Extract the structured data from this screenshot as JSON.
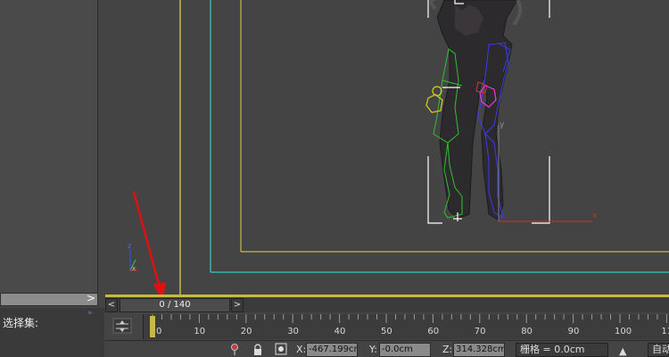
{
  "left_panel": {
    "scroll_arrow": ">",
    "selection_set_label": "选择集:",
    "collapse_chevron": "»"
  },
  "viewport": {
    "axis_y_label": "y",
    "axis_x_label": "x",
    "gizmo_z_label": "z",
    "gizmo_x_label": "x",
    "frame_colors": {
      "safe_yellow": "#c8b84a",
      "safe_cyan": "#38c8c8"
    },
    "annotation_color": "#e01010"
  },
  "time_slider": {
    "prev_label": "<",
    "next_label": ">",
    "frame_readout": "0 / 140"
  },
  "track_bar": {
    "ticks": [
      "0",
      "10",
      "20",
      "30",
      "40",
      "50",
      "60",
      "70",
      "80",
      "90",
      "100",
      "11"
    ]
  },
  "status_bar": {
    "x_label": "X:",
    "x_value": "-467.199cm",
    "y_label": "Y:",
    "y_value": "-0.0cm",
    "z_label": "Z:",
    "z_value": "314.328cm",
    "grid_label": "栅格 = 0.0cm",
    "auto_key_label": "自动"
  }
}
